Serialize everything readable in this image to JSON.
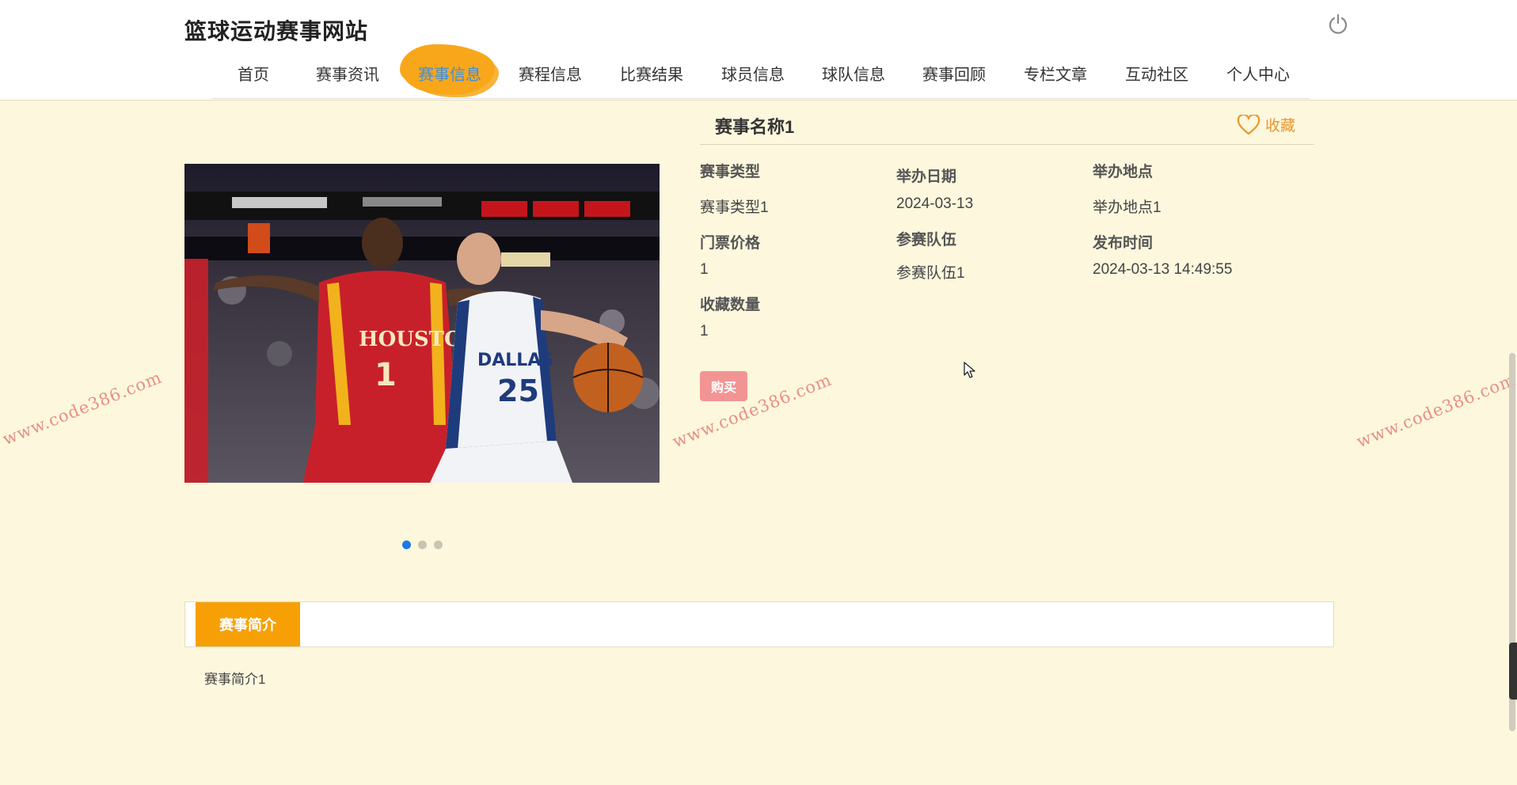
{
  "header": {
    "site_title": "篮球运动赛事网站",
    "nav": [
      {
        "label": "首页"
      },
      {
        "label": "赛事资讯"
      },
      {
        "label": "赛事信息"
      },
      {
        "label": "赛程信息"
      },
      {
        "label": "比赛结果"
      },
      {
        "label": "球员信息"
      },
      {
        "label": "球队信息"
      },
      {
        "label": "赛事回顾"
      },
      {
        "label": "专栏文章"
      },
      {
        "label": "互动社区"
      },
      {
        "label": "个人中心"
      }
    ],
    "active_nav": "赛事信息"
  },
  "detail": {
    "title": "赛事名称1",
    "favorite_label": "收藏",
    "fields": {
      "type_label": "赛事类型",
      "type_value": "赛事类型1",
      "date_label": "举办日期",
      "date_value": "2024-03-13",
      "place_label": "举办地点",
      "place_value": "举办地点1",
      "price_label": "门票价格",
      "price_value": "1",
      "teams_label": "参赛队伍",
      "teams_value": "参赛队伍1",
      "pub_label": "发布时间",
      "pub_value": "2024-03-13 14:49:55",
      "fav_count_label": "收藏数量",
      "fav_count_value": "1"
    },
    "buy_label": "购买"
  },
  "carousel": {
    "slides": 3,
    "active": 0
  },
  "tabs": {
    "active_label": "赛事简介",
    "content": "赛事简介1"
  },
  "watermark": "www.code386.com",
  "colors": {
    "accent_orange": "#f7a006",
    "nav_active": "#3d8fe0",
    "buy_button": "#f29494",
    "favorite": "#e8962c",
    "background": "#fcf7dd"
  },
  "icons": [
    "power-icon",
    "heart-icon",
    "cursor-icon"
  ]
}
